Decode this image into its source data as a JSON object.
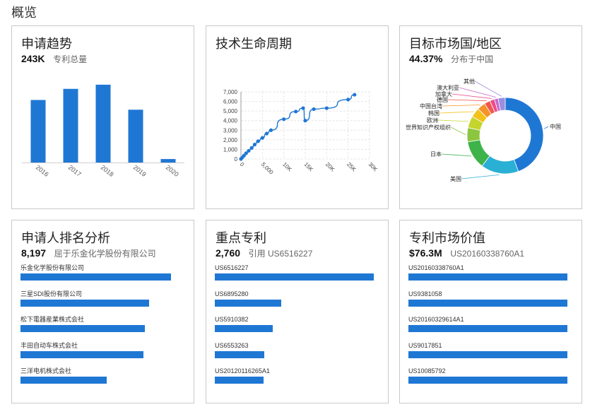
{
  "page": {
    "title": "概览"
  },
  "cards": {
    "trend": {
      "title": "申请趋势",
      "value": "243K",
      "caption": "专利总量",
      "chart_data": {
        "type": "bar",
        "categories": [
          "2016",
          "2017",
          "2018",
          "2019",
          "2020"
        ],
        "values": [
          45,
          53,
          56,
          38,
          2.5
        ],
        "ylim": [
          0,
          60
        ],
        "grid": false,
        "color": "#1f77d4"
      }
    },
    "lifecycle": {
      "title": "技术生命周期",
      "chart_data": {
        "type": "line",
        "x_ticks": [
          "0",
          "5,000",
          "10K",
          "15K",
          "20K",
          "25K",
          "30K"
        ],
        "x_tick_values": [
          0,
          5000,
          10000,
          15000,
          20000,
          25000,
          30000
        ],
        "y_ticks": [
          "0",
          "1,000",
          "2,000",
          "3,000",
          "4,000",
          "5,000",
          "6,000",
          "7,000"
        ],
        "y_tick_values": [
          0,
          1000,
          2000,
          3000,
          4000,
          5000,
          6000,
          7000
        ],
        "xlim": [
          0,
          30000
        ],
        "ylim": [
          0,
          7000
        ],
        "grid": true,
        "color": "#1f77d4",
        "points": [
          [
            0,
            0
          ],
          [
            300,
            150
          ],
          [
            700,
            350
          ],
          [
            1200,
            600
          ],
          [
            1800,
            850
          ],
          [
            2500,
            1150
          ],
          [
            3200,
            1500
          ],
          [
            4000,
            1850
          ],
          [
            5000,
            2200
          ],
          [
            6000,
            2650
          ],
          [
            7000,
            3000
          ],
          [
            10000,
            4150
          ],
          [
            12800,
            4950
          ],
          [
            14500,
            5300
          ],
          [
            15000,
            4000
          ],
          [
            17000,
            5200
          ],
          [
            20000,
            5300
          ],
          [
            25000,
            6200
          ],
          [
            26500,
            6700
          ]
        ]
      }
    },
    "market": {
      "title": "目标市场国/地区",
      "value": "44.37%",
      "caption": "分布于中国",
      "chart_data": {
        "type": "pie",
        "donut": true,
        "slices": [
          {
            "label": "中国",
            "value": 44.37,
            "color": "#1f77d4"
          },
          {
            "label": "美国",
            "value": 16,
            "color": "#2ab0d4"
          },
          {
            "label": "日本",
            "value": 12,
            "color": "#3db34a"
          },
          {
            "label": "世界知识产权组织",
            "value": 6,
            "color": "#8cc63f"
          },
          {
            "label": "欧洲",
            "value": 5,
            "color": "#c4d52e"
          },
          {
            "label": "韩国",
            "value": 4,
            "color": "#f2c21a"
          },
          {
            "label": "中国台湾",
            "value": 3.5,
            "color": "#f5932a"
          },
          {
            "label": "德国",
            "value": 2.5,
            "color": "#f0584c"
          },
          {
            "label": "加拿大",
            "value": 2,
            "color": "#ee4b8c"
          },
          {
            "label": "澳大利亚",
            "value": 1.6,
            "color": "#c869c9"
          },
          {
            "label": "其他",
            "value": 3,
            "color": "#9b8ee0"
          }
        ]
      }
    },
    "applicants": {
      "title": "申请人排名分析",
      "value": "8,197",
      "caption": "屈于乐金化学股份有限公司",
      "chart_data": {
        "type": "bar",
        "orientation": "horizontal",
        "categories": [
          "乐金化学股份有限公司",
          "三星SDI股份有限公司",
          "松下電器産業株式会社",
          "丰田自动车株式会社",
          "三洋电机株式会社"
        ],
        "values": [
          8197,
          7000,
          6750,
          6700,
          4700
        ],
        "xlim": [
          0,
          8650
        ],
        "color": "#1f77d4"
      }
    },
    "key_patents": {
      "title": "重点专利",
      "value": "2,760",
      "caption": "引用 US6516227",
      "chart_data": {
        "type": "bar",
        "orientation": "horizontal",
        "categories": [
          "US6516227",
          "US6895280",
          "US5910382",
          "US6553263",
          "US20120116265A1"
        ],
        "values": [
          2760,
          1150,
          1010,
          860,
          850
        ],
        "xlim": [
          0,
          2760
        ],
        "color": "#1f77d4"
      }
    },
    "value": {
      "title": "专利市场价值",
      "value": "$76.3M",
      "caption": "US20160338760A1",
      "chart_data": {
        "type": "bar",
        "orientation": "horizontal",
        "categories": [
          "US20160338760A1",
          "US9381058",
          "US20160329614A1",
          "US9017851",
          "US10085792"
        ],
        "values": [
          76.3,
          76.3,
          76.3,
          76.3,
          76.3
        ],
        "xlim": [
          0,
          76.3
        ],
        "color": "#1f77d4"
      }
    }
  }
}
